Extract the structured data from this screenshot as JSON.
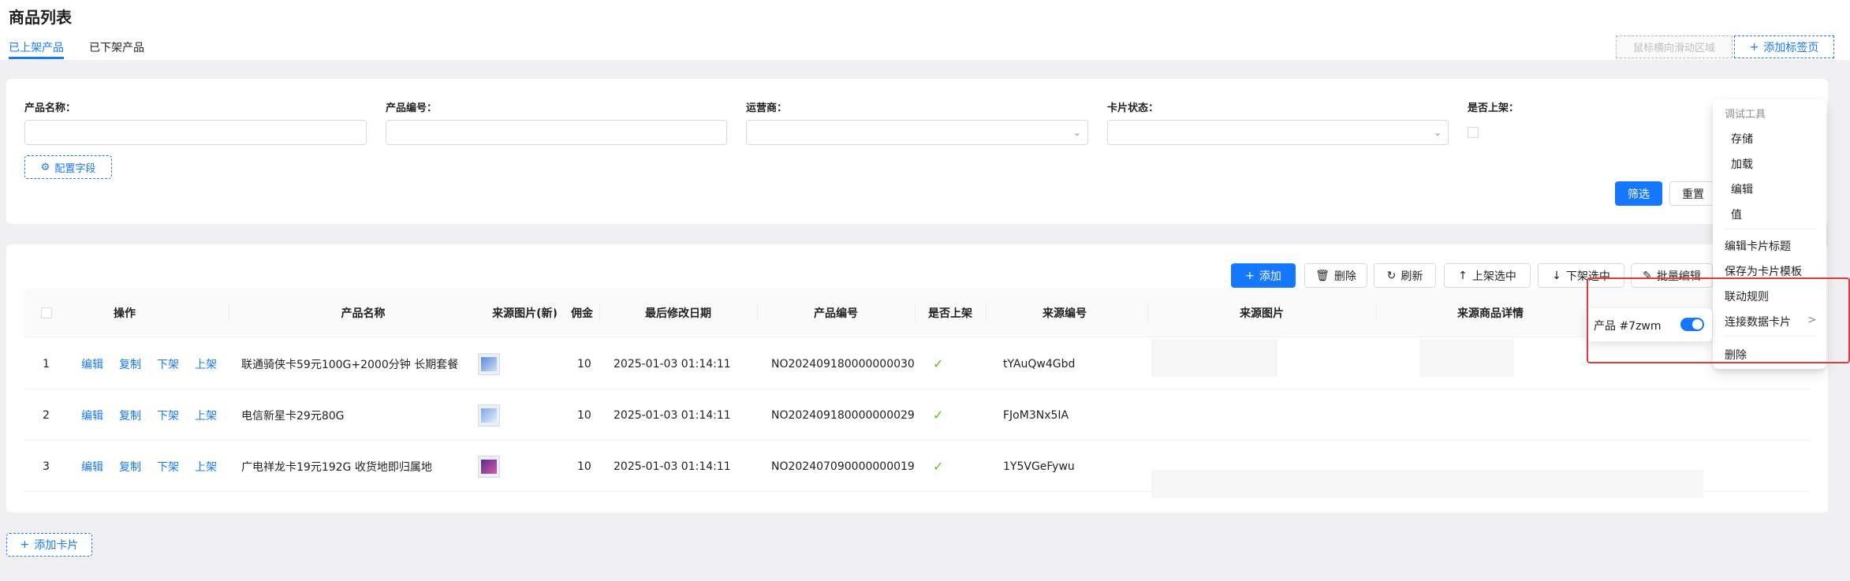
{
  "page": {
    "title": "商品列表"
  },
  "tabs": [
    {
      "label": "已上架产品",
      "active": true
    },
    {
      "label": "已下架产品",
      "active": false
    }
  ],
  "tab_bar": {
    "scroll_zone": "鼠标横向滑动区域",
    "add_tab": "添加标签页"
  },
  "filters": {
    "fields": [
      {
        "label": "产品名称：",
        "type": "text"
      },
      {
        "label": "产品编号：",
        "type": "text"
      },
      {
        "label": "运营商：",
        "type": "select"
      },
      {
        "label": "卡片状态：",
        "type": "select"
      },
      {
        "label": "是否上架：",
        "type": "checkbox"
      }
    ],
    "config_button": "配置字段",
    "filter_button": "筛选",
    "reset_button": "重置"
  },
  "toolbar": {
    "add": "添加",
    "delete": "删除",
    "refresh": "刷新",
    "shelve_selected": "上架选中",
    "unshelve_selected": "下架选中",
    "batch_edit": "批量编辑"
  },
  "table": {
    "columns": [
      "操作",
      "产品名称",
      "来源图片(新)",
      "佣金",
      "最后修改日期",
      "产品编号",
      "是否上架",
      "来源编号",
      "来源图片",
      "来源商品详情"
    ],
    "actions": [
      "编辑",
      "复制",
      "下架",
      "上架"
    ],
    "rows": [
      {
        "index": "1",
        "name": "联通骑侠卡59元100G+2000分钟 长期套餐",
        "commission": "10",
        "modified": "2025-01-03 01:14:11",
        "product_no": "NO202409180000000030",
        "listed": "✓",
        "source_no": "tYAuQw4Gbd"
      },
      {
        "index": "2",
        "name": "电信新星卡29元80G",
        "commission": "10",
        "modified": "2025-01-03 01:14:11",
        "product_no": "NO202409180000000029",
        "listed": "✓",
        "source_no": "FJoM3Nx5IA"
      },
      {
        "index": "3",
        "name": "广电祥龙卡19元192G 收货地即归属地",
        "commission": "10",
        "modified": "2025-01-03 01:14:11",
        "product_no": "NO202407090000000019",
        "listed": "✓",
        "source_no": "1Y5VGeFywu"
      }
    ]
  },
  "add_card": "添加卡片",
  "context_menu": {
    "group_title": "调试工具",
    "debug_items": [
      "存储",
      "加载",
      "编辑",
      "值"
    ],
    "items": [
      "编辑卡片标题",
      "保存为卡片模板",
      "联动规则",
      "连接数据卡片"
    ],
    "delete": "删除",
    "submenu": {
      "label": "产品 #7zwm",
      "enabled": true
    }
  },
  "colors": {
    "primary": "#1677ff",
    "highlight": "#e03a3a",
    "success": "#52c41a"
  }
}
